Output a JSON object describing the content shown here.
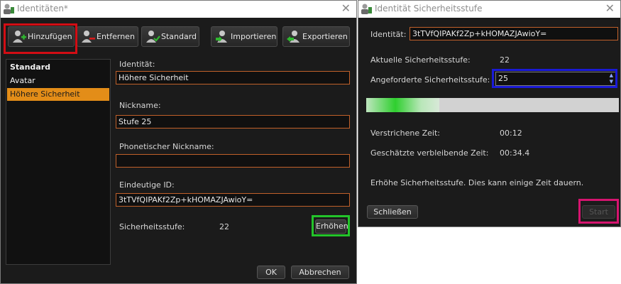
{
  "left_window": {
    "title": "Identitäten*",
    "toolbar": {
      "add_label": "Hinzufügen",
      "remove_label": "Entfernen",
      "standard_label": "Standard",
      "import_label": "Importieren",
      "export_label": "Exportieren"
    },
    "identities": [
      "Standard",
      "Avatar",
      "Höhere Sicherheit"
    ],
    "selected_identity": "Höhere Sicherheit",
    "form": {
      "identity_label": "Identität:",
      "identity_value": "Höhere Sicherheit",
      "nickname_label": "Nickname:",
      "nickname_value": "Stufe 25",
      "phonetic_label": "Phonetischer Nickname:",
      "phonetic_value": "",
      "unique_id_label": "Eindeutige ID:",
      "unique_id_value": "3tTVfQIPAKf2Zp+kHOMAZJAwioY=",
      "security_level_label": "Sicherheitsstufe:",
      "security_level_value": "22",
      "raise_label": "Erhöhen"
    },
    "ok_label": "OK",
    "cancel_label": "Abbrechen"
  },
  "right_window": {
    "title": "Identität Sicherheitsstufe",
    "identity_label": "Identität:",
    "identity_value": "3tTVfQIPAKf2Zp+kHOMAZJAwioY=",
    "current_level_label": "Aktuelle Sicherheitsstufe:",
    "current_level_value": "22",
    "requested_level_label": "Angeforderte Sicherheitsstufe:",
    "requested_level_value": "25",
    "progress_fraction": 0.29,
    "elapsed_label": "Verstrichene Zeit:",
    "elapsed_value": "00:12",
    "remaining_label": "Geschätzte verbleibende Zeit:",
    "remaining_value": "00:34.4",
    "status_text": "Erhöhe Sicherheitsstufe. Dies kann einige Zeit dauern.",
    "close_label": "Schließen",
    "start_label": "Start"
  },
  "colors": {
    "window_bg": "#1b1b1b",
    "field_border": "#c0602a",
    "selection": "#e38d18",
    "highlight_red": "#d20d14",
    "highlight_green": "#23c42a",
    "highlight_blue": "#1a1ad6",
    "highlight_pink": "#d6146f"
  },
  "icons": [
    "user-icon",
    "add-user-icon",
    "remove-user-icon",
    "default-user-icon",
    "import-user-icon",
    "export-user-icon",
    "close-icon",
    "spin-up-icon",
    "spin-down-icon"
  ]
}
